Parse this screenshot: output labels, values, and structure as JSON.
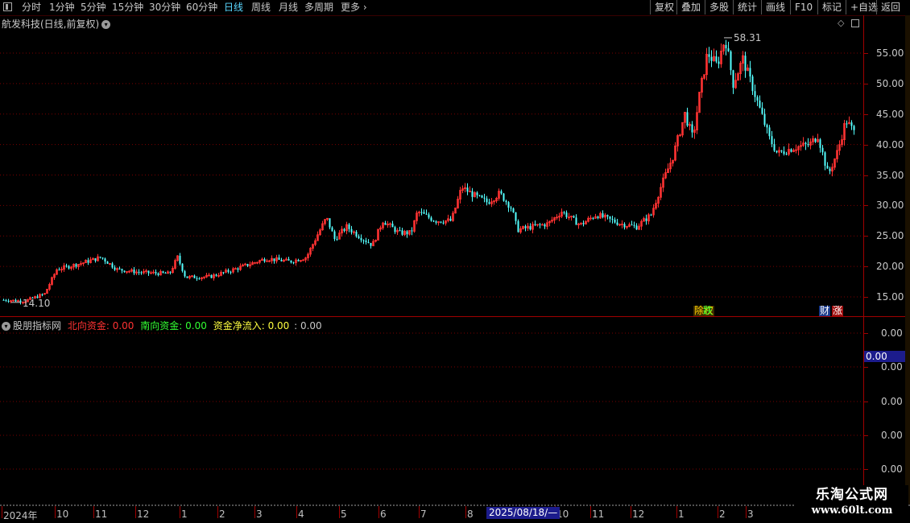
{
  "toolbar": {
    "periods": [
      "分时",
      "1分钟",
      "5分钟",
      "15分钟",
      "30分钟",
      "60分钟",
      "日线",
      "周线",
      "月线",
      "多周期",
      "更多"
    ],
    "active_period": "日线",
    "right_buttons": [
      "复权",
      "叠加",
      "多股",
      "统计",
      "画线",
      "F10",
      "标记",
      "+自选",
      "返回"
    ]
  },
  "main_chart": {
    "title": "航发科技(日线,前复权)",
    "price_labels": [
      "55.00",
      "50.00",
      "45.00",
      "40.00",
      "35.00",
      "30.00",
      "25.00",
      "20.00",
      "15.00"
    ],
    "high_marker": "58.31",
    "low_marker": "14.10",
    "event_tags": {
      "left": "除权",
      "left2": "跌",
      "finance": "财",
      "up": "涨"
    },
    "colors": {
      "up": "#ff3232",
      "down": "#54ffff",
      "grid": "#7a0000",
      "axis": "#a00000"
    }
  },
  "indicator": {
    "name": "股朋指标网",
    "north": {
      "label": "北向资金:",
      "value": "0.00",
      "color": "#ff3232"
    },
    "south": {
      "label": "南向资金:",
      "value": "0.00",
      "color": "#32ff32"
    },
    "net": {
      "label": "资金净流入:",
      "value": "0.00",
      "color": "#ffff40"
    },
    "extra": ": 0.00",
    "axis_labels": [
      "0.00",
      "0.00",
      "0.00",
      "0.00",
      "0.00"
    ],
    "current_value": "0.00"
  },
  "x_axis": {
    "labels": [
      "2024年",
      "10",
      "11",
      "12",
      "1",
      "2",
      "3",
      "4",
      "5",
      "6",
      "7",
      "8",
      "10",
      "11",
      "12",
      "1",
      "2",
      "3"
    ],
    "cursor_date": "2025/08/18/—"
  },
  "watermark": {
    "line1": "乐淘公式网",
    "line2": "www.60lt.com"
  },
  "chart_data": {
    "type": "candlestick",
    "title": "航发科技(日线,前复权)",
    "ylim": [
      12,
      60
    ],
    "x_ticks": [
      "2024年",
      "10",
      "11",
      "12",
      "1",
      "2",
      "3",
      "4",
      "5",
      "6",
      "7",
      "8",
      "10",
      "11",
      "12",
      "1",
      "2",
      "3"
    ],
    "approx_close_path": [
      [
        "2024-09",
        14.5
      ],
      [
        "2024-10",
        19.5
      ],
      [
        "2024-11",
        21.0
      ],
      [
        "2024-12",
        19.0
      ],
      [
        "2025-01",
        18.5
      ],
      [
        "2025-01b",
        21.5
      ],
      [
        "2025-02",
        18.5
      ],
      [
        "2025-03",
        20.0
      ],
      [
        "2025-04",
        21.0
      ],
      [
        "2025-04b",
        27.0
      ],
      [
        "2025-05",
        25.0
      ],
      [
        "2025-06",
        27.0
      ],
      [
        "2025-07",
        28.0
      ],
      [
        "2025-08",
        32.0
      ],
      [
        "2025-08b",
        31.0
      ],
      [
        "2025-09",
        26.5
      ],
      [
        "2025-10",
        28.5
      ],
      [
        "2025-11",
        27.5
      ],
      [
        "2025-12",
        29.0
      ],
      [
        "2026-01",
        40.0
      ],
      [
        "2026-01b",
        52.0
      ],
      [
        "2026-02",
        55.0
      ],
      [
        "2026-02b",
        48.0
      ],
      [
        "2026-03",
        40.0
      ],
      [
        "2026-03b",
        37.0
      ],
      [
        "2026-04",
        43.0
      ]
    ],
    "max_price": 58.31,
    "min_price": 14.1
  }
}
